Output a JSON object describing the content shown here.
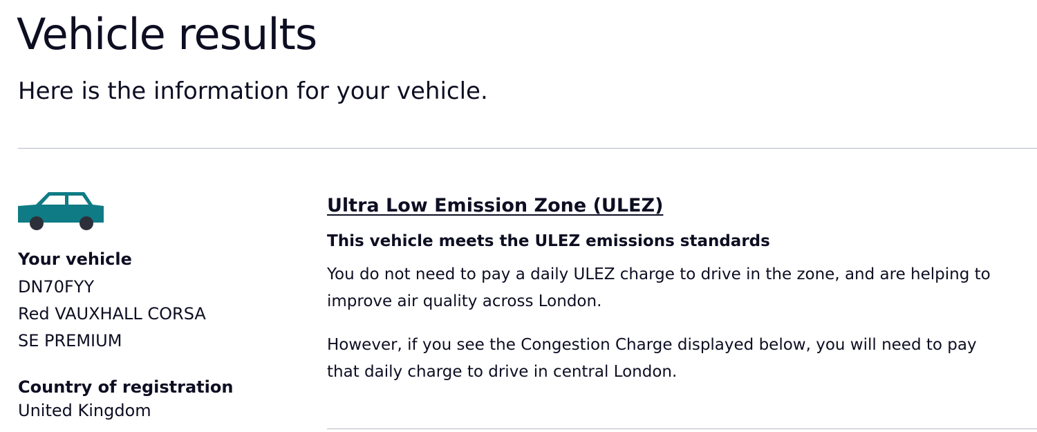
{
  "page": {
    "title": "Vehicle results",
    "intro": "Here is the information for your vehicle."
  },
  "vehicle": {
    "icon": "car-icon",
    "icon_color": "#0f7b85",
    "wheel_color": "#2d2f3a",
    "label": "Your vehicle",
    "registration": "DN70FYY",
    "description_line1": "Red VAUXHALL CORSA",
    "description_line2": "SE PREMIUM",
    "country_label": "Country of registration",
    "country_value": "United Kingdom"
  },
  "ulez": {
    "link_text": "Ultra Low Emission Zone (ULEZ)",
    "status_heading": "This vehicle meets the ULEZ emissions standards",
    "paragraph1": "You do not need to pay a daily ULEZ charge to drive in the zone, and are helping to improve air quality across London.",
    "paragraph2": "However, if you see the Congestion Charge displayed below, you will need to pay that daily charge to drive in central London."
  }
}
